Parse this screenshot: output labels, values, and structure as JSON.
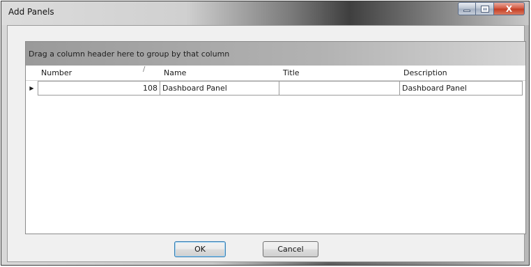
{
  "window": {
    "title": "Add Panels",
    "close_glyph": "X"
  },
  "grid": {
    "group_panel_text": "Drag a column header here to group by that column",
    "sort_indicator": "/",
    "columns": [
      "Number",
      "Name",
      "Title",
      "Description"
    ],
    "rows": [
      {
        "number": "108",
        "name": "Dashboard Panel",
        "title": "",
        "description": "Dashboard Panel"
      }
    ],
    "row_indicator": "▶"
  },
  "buttons": {
    "ok_label": "OK",
    "cancel_label": "Cancel"
  },
  "colors": {
    "accent_default_button": "#3c7fb1",
    "close_button": "#c43c22"
  },
  "icons": [
    "minimize-icon",
    "maximize-icon",
    "close-icon",
    "row-indicator-icon",
    "sort-icon"
  ]
}
